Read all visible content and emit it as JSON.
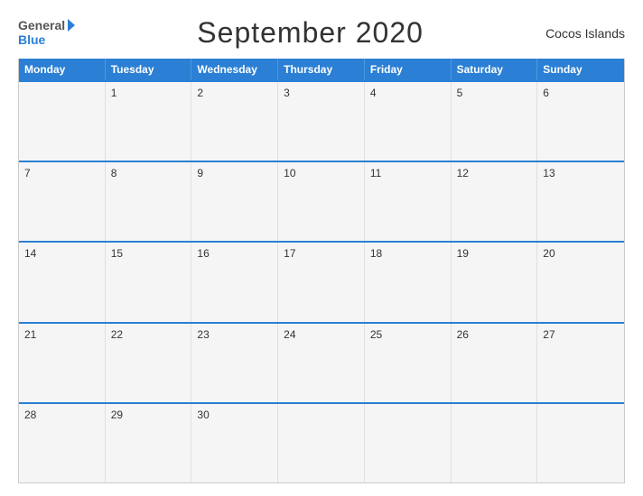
{
  "header": {
    "logo_general": "General",
    "logo_blue": "Blue",
    "title": "September 2020",
    "region": "Cocos Islands"
  },
  "calendar": {
    "days": [
      "Monday",
      "Tuesday",
      "Wednesday",
      "Thursday",
      "Friday",
      "Saturday",
      "Sunday"
    ],
    "weeks": [
      [
        "",
        "1",
        "2",
        "3",
        "4",
        "5",
        "6"
      ],
      [
        "7",
        "8",
        "9",
        "10",
        "11",
        "12",
        "13"
      ],
      [
        "14",
        "15",
        "16",
        "17",
        "18",
        "19",
        "20"
      ],
      [
        "21",
        "22",
        "23",
        "24",
        "25",
        "26",
        "27"
      ],
      [
        "28",
        "29",
        "30",
        "",
        "",
        "",
        ""
      ]
    ]
  }
}
